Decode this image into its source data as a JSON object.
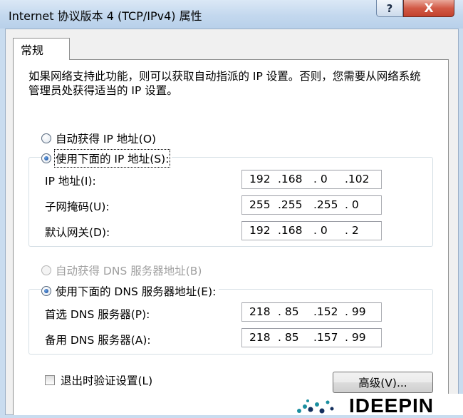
{
  "window": {
    "title": "Internet 协议版本 4 (TCP/IPv4) 属性",
    "help_label": "?",
    "close_label": "X"
  },
  "tabs": [
    {
      "label": "常规"
    }
  ],
  "description": "如果网络支持此功能，则可以获取自动指派的 IP 设置。否则，您需要从网络系统管理员处获得适当的 IP 设置。",
  "ip_section": {
    "auto_label": "自动获得 IP 地址(O)",
    "manual_label": "使用下面的 IP 地址(S):",
    "selected": "manual",
    "fields": [
      {
        "label": "IP 地址(I):",
        "octets": [
          "192",
          ".168",
          ". 0",
          ".102"
        ]
      },
      {
        "label": "子网掩码(U):",
        "octets": [
          "255",
          ".255",
          ".255",
          ". 0"
        ]
      },
      {
        "label": "默认网关(D):",
        "octets": [
          "192",
          ".168",
          ". 0",
          ". 2"
        ]
      }
    ]
  },
  "dns_section": {
    "auto_label": "自动获得 DNS 服务器地址(B)",
    "manual_label": "使用下面的 DNS 服务器地址(E):",
    "selected": "manual",
    "auto_enabled": false,
    "fields": [
      {
        "label": "首选 DNS 服务器(P):",
        "octets": [
          "218",
          ". 85",
          ".152",
          ". 99"
        ]
      },
      {
        "label": "备用 DNS 服务器(A):",
        "octets": [
          "218",
          ". 85",
          ".157",
          ". 99"
        ]
      }
    ]
  },
  "validate_on_exit": {
    "label": "退出时验证设置(L)",
    "checked": false
  },
  "advanced_button": "高级(V)...",
  "watermark": {
    "text": "IDEEPIN"
  },
  "colors": {
    "close_red": "#c2412d",
    "title_bar": "#c3d8ee",
    "watermark_teal": "#1b8fa0",
    "watermark_navy": "#14305e"
  }
}
